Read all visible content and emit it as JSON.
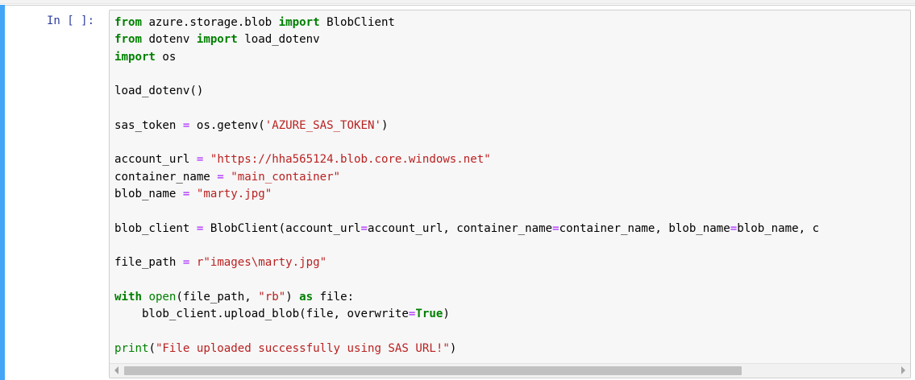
{
  "notebook": {
    "prompt": "In [ ]:",
    "code_lines": [
      [
        {
          "t": "from",
          "c": "kw"
        },
        {
          "t": " azure.storage.blob ",
          "c": ""
        },
        {
          "t": "import",
          "c": "kw"
        },
        {
          "t": " BlobClient",
          "c": ""
        }
      ],
      [
        {
          "t": "from",
          "c": "kw"
        },
        {
          "t": " dotenv ",
          "c": ""
        },
        {
          "t": "import",
          "c": "kw"
        },
        {
          "t": " load_dotenv",
          "c": ""
        }
      ],
      [
        {
          "t": "import",
          "c": "kw"
        },
        {
          "t": " os",
          "c": ""
        }
      ],
      [],
      [
        {
          "t": "load_dotenv()",
          "c": ""
        }
      ],
      [],
      [
        {
          "t": "sas_token ",
          "c": ""
        },
        {
          "t": "=",
          "c": "op"
        },
        {
          "t": " os.getenv(",
          "c": ""
        },
        {
          "t": "'AZURE_SAS_TOKEN'",
          "c": "str"
        },
        {
          "t": ")",
          "c": ""
        }
      ],
      [],
      [
        {
          "t": "account_url ",
          "c": ""
        },
        {
          "t": "=",
          "c": "op"
        },
        {
          "t": " ",
          "c": ""
        },
        {
          "t": "\"https://hha565124.blob.core.windows.net\"",
          "c": "str"
        }
      ],
      [
        {
          "t": "container_name ",
          "c": ""
        },
        {
          "t": "=",
          "c": "op"
        },
        {
          "t": " ",
          "c": ""
        },
        {
          "t": "\"main_container\"",
          "c": "str"
        }
      ],
      [
        {
          "t": "blob_name ",
          "c": ""
        },
        {
          "t": "=",
          "c": "op"
        },
        {
          "t": " ",
          "c": ""
        },
        {
          "t": "\"marty.jpg\"",
          "c": "str"
        }
      ],
      [],
      [
        {
          "t": "blob_client ",
          "c": ""
        },
        {
          "t": "=",
          "c": "op"
        },
        {
          "t": " BlobClient(account_url",
          "c": ""
        },
        {
          "t": "=",
          "c": "op"
        },
        {
          "t": "account_url, container_name",
          "c": ""
        },
        {
          "t": "=",
          "c": "op"
        },
        {
          "t": "container_name, blob_name",
          "c": ""
        },
        {
          "t": "=",
          "c": "op"
        },
        {
          "t": "blob_name, c",
          "c": ""
        }
      ],
      [],
      [
        {
          "t": "file_path ",
          "c": ""
        },
        {
          "t": "=",
          "c": "op"
        },
        {
          "t": " ",
          "c": ""
        },
        {
          "t": "r\"images\\marty.jpg\"",
          "c": "str"
        }
      ],
      [],
      [
        {
          "t": "with",
          "c": "kw"
        },
        {
          "t": " ",
          "c": ""
        },
        {
          "t": "open",
          "c": "bi"
        },
        {
          "t": "(file_path, ",
          "c": ""
        },
        {
          "t": "\"rb\"",
          "c": "str"
        },
        {
          "t": ") ",
          "c": ""
        },
        {
          "t": "as",
          "c": "kw"
        },
        {
          "t": " file:",
          "c": ""
        }
      ],
      [
        {
          "t": "    blob_client.upload_blob(file, overwrite",
          "c": ""
        },
        {
          "t": "=",
          "c": "op"
        },
        {
          "t": "True",
          "c": "kw"
        },
        {
          "t": ")",
          "c": ""
        }
      ],
      [],
      [
        {
          "t": "print",
          "c": "bi"
        },
        {
          "t": "(",
          "c": ""
        },
        {
          "t": "\"File uploaded successfully using SAS URL!\"",
          "c": "str"
        },
        {
          "t": ")",
          "c": ""
        }
      ]
    ],
    "horizontal_scroll_fraction": 0.8
  },
  "icons": {
    "scroll_left": "scroll-left-arrow-icon",
    "scroll_right": "scroll-right-arrow-icon"
  },
  "colors": {
    "keyword": "#008000",
    "operator": "#aa22ff",
    "string": "#ba2121",
    "prompt": "#303f9f",
    "cell_accent": "#42a5f5",
    "editor_bg": "#f7f7f7"
  }
}
